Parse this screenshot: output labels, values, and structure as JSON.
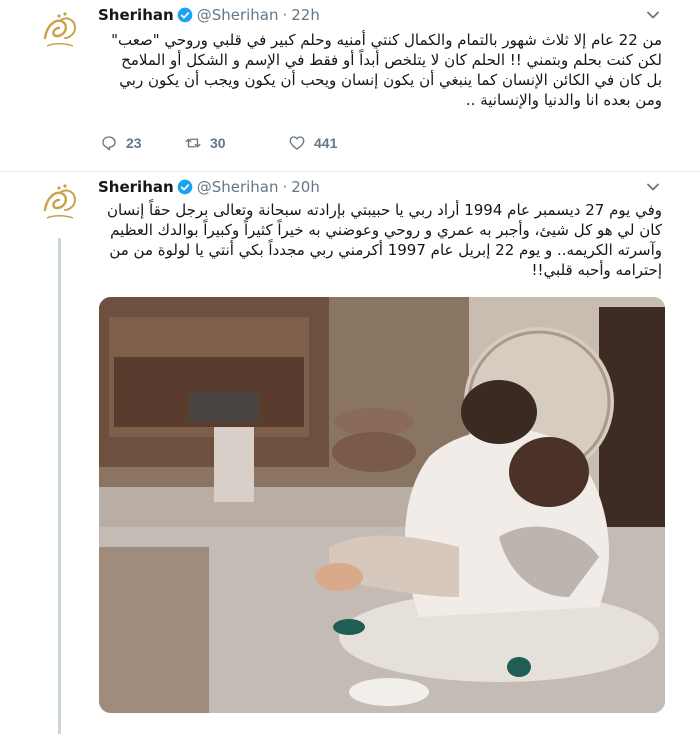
{
  "tweets": [
    {
      "author": {
        "name": "Sherihan",
        "handle": "@Sherihan",
        "time": "22h"
      },
      "lines": [
        "من 22 عام إلا ثلاث شهور بالتمام والكمال كنتي أمنيه وحلم كبير في قلبي وروحي \"صعب\"",
        "لكن كنت بحلم وبتمني !! الحلم كان لا يتلخص أبداً أو فقط في الإسم و الشكل أو الملامح",
        "بل كان في الكائن الإنسان كما ينبغي أن يكون إنسان ويحب أن يكون ويجب أن يكون ربي",
        "ومن بعده انا والدنيا والإنسانية .."
      ],
      "stats": {
        "replies": "23",
        "retweets": "30",
        "likes": "441"
      }
    },
    {
      "author": {
        "name": "Sherihan",
        "handle": "@Sherihan",
        "time": "20h"
      },
      "lines": [
        "وفي يوم 27 ديسمبر عام 1994 أراد ربي يا حبيبتي بإرادته سبحانة وتعالى برجل حقاً إنسان",
        "كان لي هو كل شيئ، وأجبر به عمري و روحي وعوضني به خيراً كثيراً وكبيراً بوالدك العظيم",
        "وآسرته الكريمه..  و يوم  22 إبريل عام 1997 أكرمني ربي مجدداً بكي أنتي يا لولوة من من",
        "إحترامه وأحبه قلبي!!"
      ]
    }
  ],
  "colors": {
    "text": "#14171a",
    "muted": "#657786",
    "verified": "#1da1f2",
    "divider": "#e6ecf0",
    "avatar_gold": "#c9a24a"
  },
  "icons": [
    "avatar-logo-icon",
    "verified-badge-icon",
    "caret-down-icon",
    "reply-icon",
    "retweet-icon",
    "like-icon"
  ]
}
